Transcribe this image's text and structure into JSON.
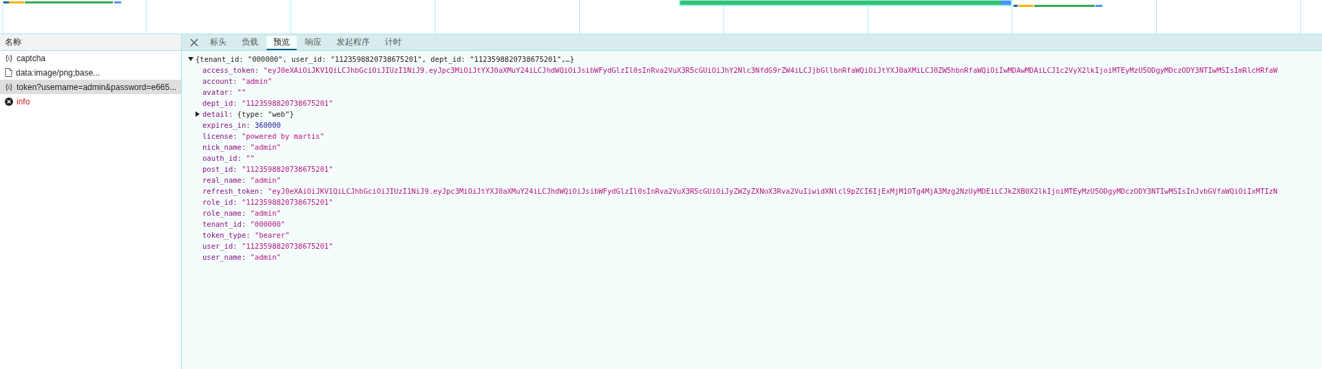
{
  "requests_header": "名称",
  "requests": [
    {
      "name": "captcha",
      "kind": "fetch",
      "selected": false
    },
    {
      "name": "data:image/png;base...",
      "kind": "document",
      "selected": false
    },
    {
      "name": "token?username=admin&password=e665...",
      "kind": "fetch",
      "selected": true
    },
    {
      "name": "info",
      "kind": "error",
      "selected": false
    }
  ],
  "tabs": [
    {
      "label": "标头",
      "selected": false
    },
    {
      "label": "负载",
      "selected": false
    },
    {
      "label": "预览",
      "selected": true
    },
    {
      "label": "响应",
      "selected": false
    },
    {
      "label": "发起程序",
      "selected": false
    },
    {
      "label": "计时",
      "selected": false
    }
  ],
  "preview": {
    "summary": "{tenant_id: \"000000\", user_id: \"1123598820738675201\", dept_id: \"1123598820738675201\",…}",
    "expanded": true,
    "properties": [
      {
        "key": "access_token:",
        "value": "\"eyJ0eXAiOiJKV1QiLCJhbGciOiJIUzI1NiJ9.eyJpc3MiOiJtYXJ0aXMuY24iLCJhdWQiOiJsibWFydGlzIl0sInRva2VuX3R5cGUiOiJhY2Nlc3NfdG9rZW4iLCJjbGllbnRfaWQiOiJtYXJ0aXMiLCJ0ZW5hbnRfaWQiOiIwMDAwMDAiLCJ1c2VyX2lkIjoiMTEyMzU5ODgyMDczODY3NTIwMSIsImRlcHRfaW",
        "kind": "string"
      },
      {
        "key": "account:",
        "value": "\"admin\"",
        "kind": "string"
      },
      {
        "key": "avatar:",
        "value": "\"\"",
        "kind": "string"
      },
      {
        "key": "dept_id:",
        "value": "\"1123598820738675201\"",
        "kind": "string"
      },
      {
        "key": "detail:",
        "value": "{type: \"web\"}",
        "kind": "object",
        "expanded": false
      },
      {
        "key": "expires_in:",
        "value": "360000",
        "kind": "number"
      },
      {
        "key": "license:",
        "value": "\"powered by martis\"",
        "kind": "string"
      },
      {
        "key": "nick_name:",
        "value": "\"admin\"",
        "kind": "string"
      },
      {
        "key": "oauth_id:",
        "value": "\"\"",
        "kind": "string"
      },
      {
        "key": "post_id:",
        "value": "\"1123598820738675201\"",
        "kind": "string"
      },
      {
        "key": "real_name:",
        "value": "\"admin\"",
        "kind": "string"
      },
      {
        "key": "refresh_token:",
        "value": "\"eyJ0eXAiOiJKV1QiLCJhbGciOiJIUzI1NiJ9.eyJpc3MiOiJtYXJ0aXMuY24iLCJhdWQiOiJsibWFydGlzIl0sInRva2VuX3R5cGUiOiJyZWZyZXNoX3Rva2VuIiwidXNlcl9pZCI6IjExMjM1OTg4MjA3Mzg2NzUyMDEiLCJkZXB0X2lkIjoiMTEyMzU5ODgyMDczODY3NTIwMSIsInJvbGVfaWQiOiIxMTIzN",
        "kind": "string"
      },
      {
        "key": "role_id:",
        "value": "\"1123598820738675201\"",
        "kind": "string"
      },
      {
        "key": "role_name:",
        "value": "\"admin\"",
        "kind": "string"
      },
      {
        "key": "tenant_id:",
        "value": "\"000000\"",
        "kind": "string"
      },
      {
        "key": "token_type:",
        "value": "\"bearer\"",
        "kind": "string"
      },
      {
        "key": "user_id:",
        "value": "\"1123598820738675201\"",
        "kind": "string"
      },
      {
        "key": "user_name:",
        "value": "\"admin\"",
        "kind": "string"
      }
    ]
  }
}
